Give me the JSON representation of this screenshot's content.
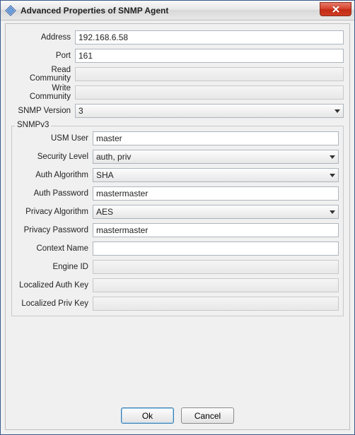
{
  "window": {
    "title": "Advanced Properties of SNMP Agent"
  },
  "labels": {
    "address": "Address",
    "port": "Port",
    "read_community": "Read Community",
    "write_community": "Write Community",
    "snmp_version": "SNMP Version",
    "group_snmpv3": "SNMPv3",
    "usm_user": "USM User",
    "security_level": "Security Level",
    "auth_algorithm": "Auth Algorithm",
    "auth_password": "Auth Password",
    "privacy_algorithm": "Privacy Algorithm",
    "privacy_password": "Privacy Password",
    "context_name": "Context Name",
    "engine_id": "Engine ID",
    "localized_auth_key": "Localized Auth Key",
    "localized_priv_key": "Localized Priv Key"
  },
  "values": {
    "address": "192.168.6.58",
    "port": "161",
    "read_community": "",
    "write_community": "",
    "snmp_version": "3",
    "usm_user": "master",
    "security_level": "auth, priv",
    "auth_algorithm": "SHA",
    "auth_password": "mastermaster",
    "privacy_algorithm": "AES",
    "privacy_password": "mastermaster",
    "context_name": "",
    "engine_id": "",
    "localized_auth_key": "",
    "localized_priv_key": ""
  },
  "buttons": {
    "ok": "Ok",
    "cancel": "Cancel"
  }
}
